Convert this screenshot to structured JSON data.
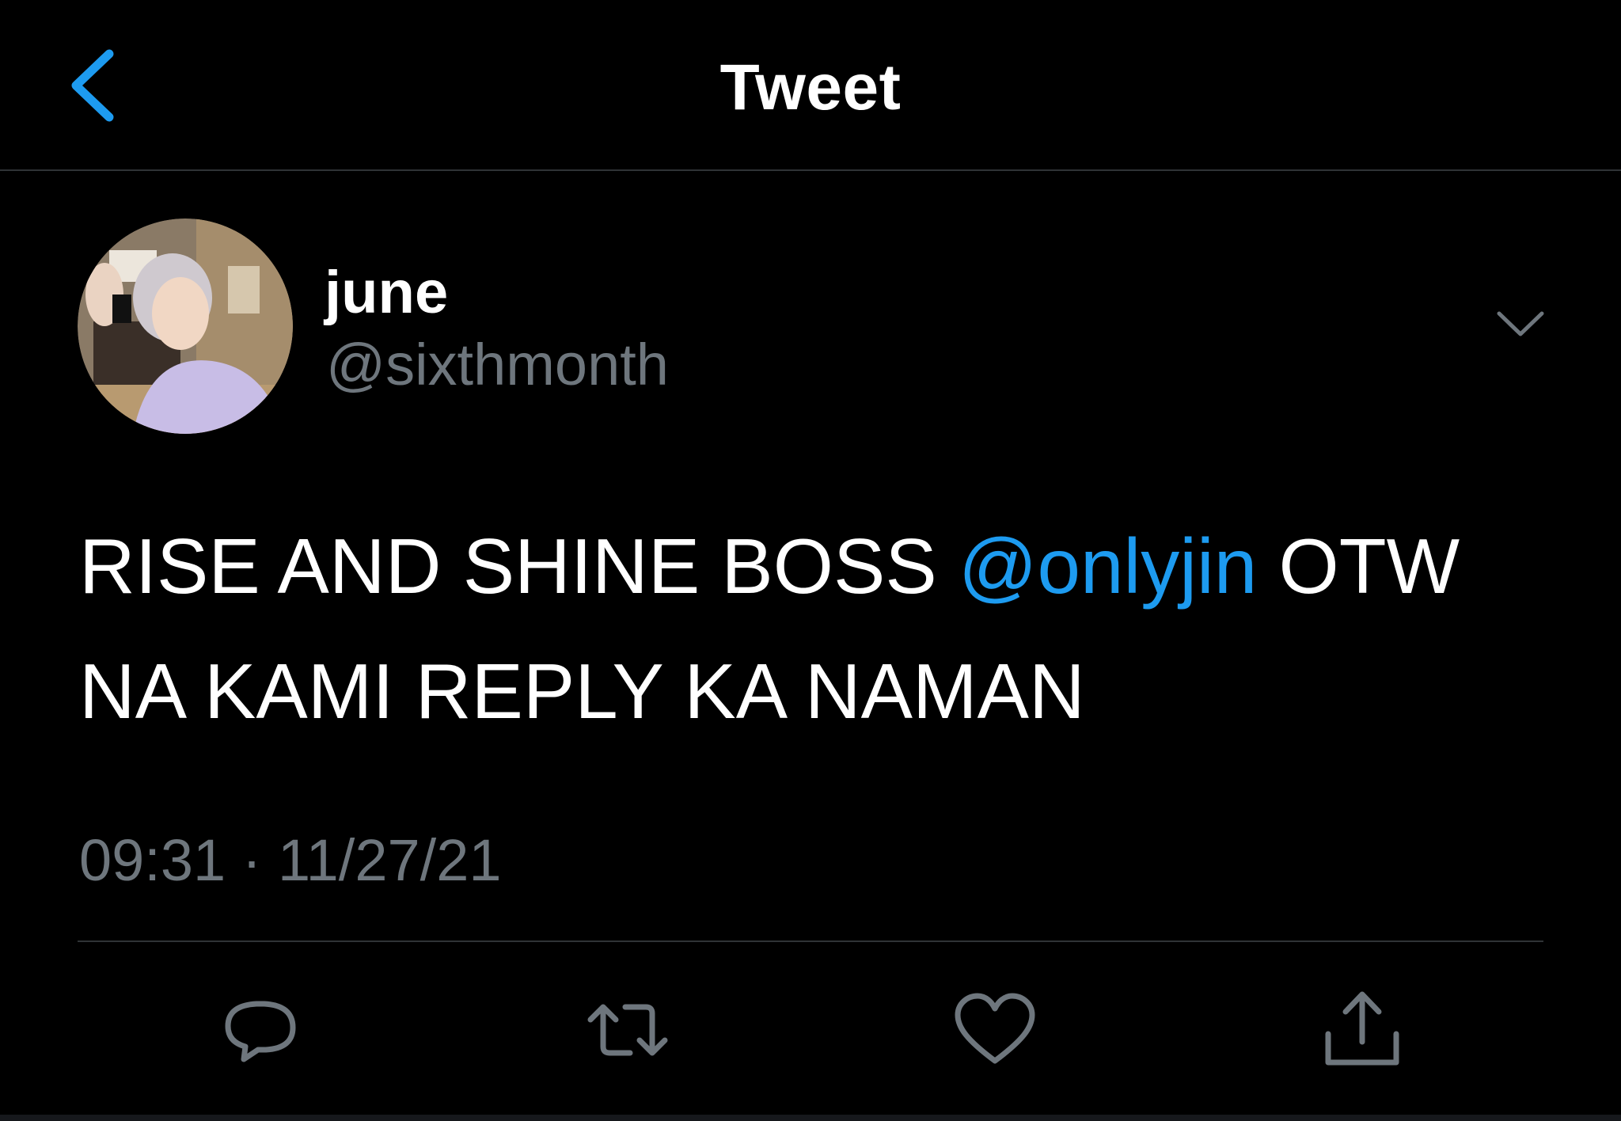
{
  "header": {
    "title": "Tweet",
    "back_icon": "chevron-left-icon"
  },
  "colors": {
    "background": "#000000",
    "accent": "#1d9bf0",
    "text_primary": "#ffffff",
    "text_secondary": "#6e767d",
    "divider": "#2f3336"
  },
  "tweet": {
    "author": {
      "name": "june",
      "handle": "@sixthmonth",
      "avatar_icon": "avatar-photo"
    },
    "text_part1": "RISE AND SHINE BOSS ",
    "mention": "@onlyjin",
    "text_part2": " OTW",
    "text_line2": "NA KAMI REPLY KA NAMAN",
    "timestamp": "09:31 · 11/27/21"
  },
  "actions": [
    {
      "icon": "reply-icon"
    },
    {
      "icon": "retweet-icon"
    },
    {
      "icon": "like-icon"
    },
    {
      "icon": "share-icon"
    }
  ]
}
